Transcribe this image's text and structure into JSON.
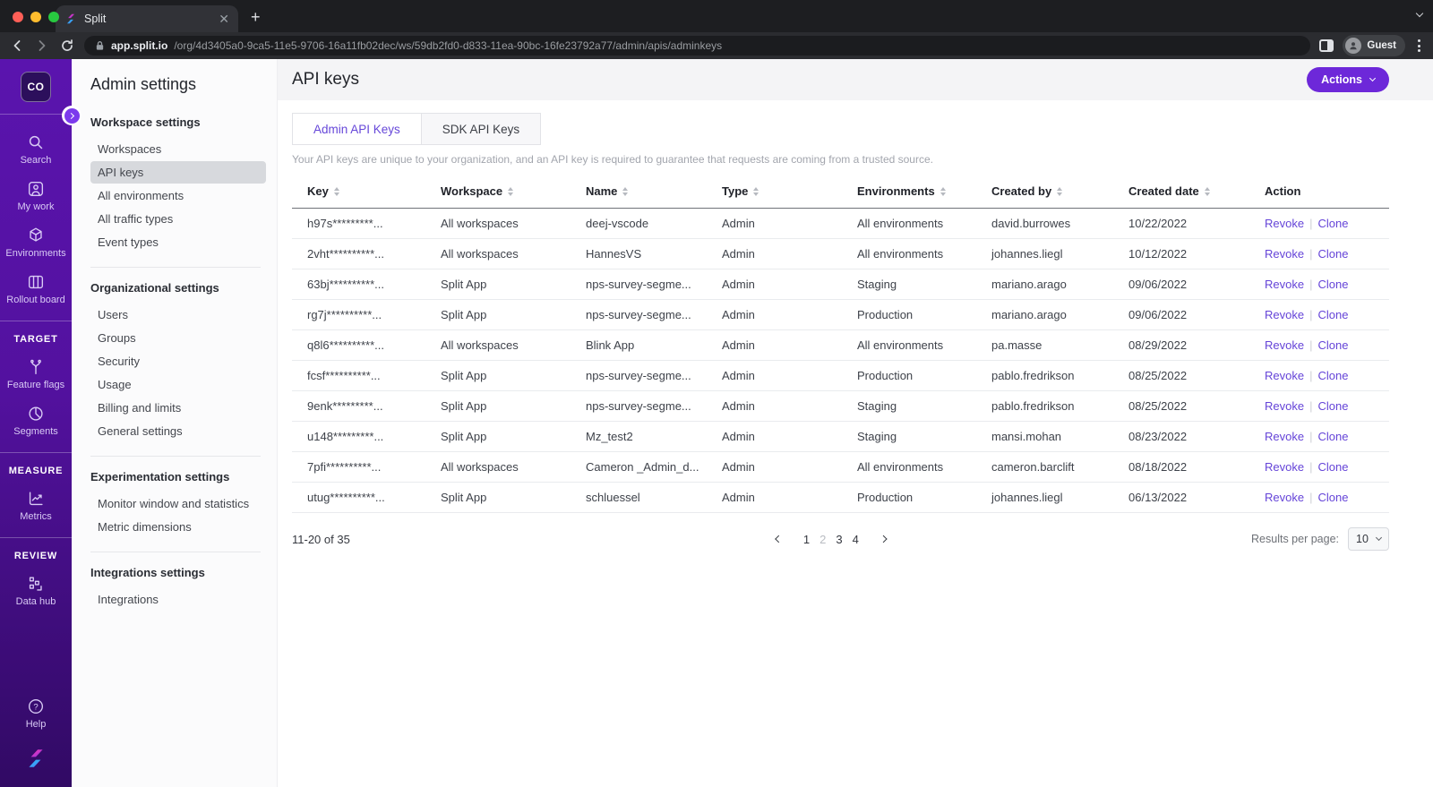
{
  "browser": {
    "tab_title": "Split",
    "url_host": "app.split.io",
    "url_path": "/org/4d3405a0-9ca5-11e5-9706-16a11fb02dec/ws/59db2fd0-d833-11ea-90bc-16fe23792a77/admin/apis/adminkeys",
    "profile_label": "Guest"
  },
  "sidebar": {
    "logo_label": "CO",
    "groups": [
      {
        "kind": "item",
        "icon": "search-icon",
        "label": "Search"
      },
      {
        "kind": "item",
        "icon": "my-work-icon",
        "label": "My work"
      },
      {
        "kind": "item",
        "icon": "environments-icon",
        "label": "Environments"
      },
      {
        "kind": "item",
        "icon": "rollout-board-icon",
        "label": "Rollout board"
      },
      {
        "kind": "divider"
      },
      {
        "kind": "heading",
        "label": "TARGET"
      },
      {
        "kind": "item",
        "icon": "feature-flags-icon",
        "label": "Feature flags"
      },
      {
        "kind": "item",
        "icon": "segments-icon",
        "label": "Segments"
      },
      {
        "kind": "divider"
      },
      {
        "kind": "heading",
        "label": "MEASURE"
      },
      {
        "kind": "item",
        "icon": "metrics-icon",
        "label": "Metrics"
      },
      {
        "kind": "divider"
      },
      {
        "kind": "heading",
        "label": "REVIEW"
      },
      {
        "kind": "item",
        "icon": "data-hub-icon",
        "label": "Data hub"
      }
    ],
    "help_label": "Help"
  },
  "admin_nav": {
    "title": "Admin settings",
    "selected": "API keys",
    "sections": [
      {
        "heading": "Workspace settings",
        "items": [
          "Workspaces",
          "API keys",
          "All environments",
          "All traffic types",
          "Event types"
        ]
      },
      {
        "heading": "Organizational settings",
        "items": [
          "Users",
          "Groups",
          "Security",
          "Usage",
          "Billing and limits",
          "General settings"
        ]
      },
      {
        "heading": "Experimentation settings",
        "items": [
          "Monitor window and statistics",
          "Metric dimensions"
        ]
      },
      {
        "heading": "Integrations settings",
        "items": [
          "Integrations"
        ]
      }
    ]
  },
  "main": {
    "title": "API keys",
    "actions_button": "Actions",
    "tabs": [
      {
        "label": "Admin API Keys",
        "active": true
      },
      {
        "label": "SDK API Keys",
        "active": false
      }
    ],
    "description": "Your API keys are unique to your organization, and an API key is required to guarantee that requests are coming from a trusted source.",
    "table": {
      "columns": [
        {
          "label": "Key",
          "sortable": true
        },
        {
          "label": "Workspace",
          "sortable": true
        },
        {
          "label": "Name",
          "sortable": true
        },
        {
          "label": "Type",
          "sortable": true
        },
        {
          "label": "Environments",
          "sortable": true
        },
        {
          "label": "Created by",
          "sortable": true
        },
        {
          "label": "Created date",
          "sortable": true
        },
        {
          "label": "Action",
          "sortable": false
        }
      ],
      "row_actions": [
        "Revoke",
        "Clone"
      ],
      "rows": [
        [
          "h97s*********...",
          "All workspaces",
          "deej-vscode",
          "Admin",
          "All environments",
          "david.burrowes",
          "10/22/2022"
        ],
        [
          "2vht**********...",
          "All workspaces",
          "HannesVS",
          "Admin",
          "All environments",
          "johannes.liegl",
          "10/12/2022"
        ],
        [
          "63bj**********...",
          "Split App",
          "nps-survey-segme...",
          "Admin",
          "Staging",
          "mariano.arago",
          "09/06/2022"
        ],
        [
          "rg7j**********...",
          "Split App",
          "nps-survey-segme...",
          "Admin",
          "Production",
          "mariano.arago",
          "09/06/2022"
        ],
        [
          "q8l6**********...",
          "All workspaces",
          "Blink App",
          "Admin",
          "All environments",
          "pa.masse",
          "08/29/2022"
        ],
        [
          "fcsf**********...",
          "Split App",
          "nps-survey-segme...",
          "Admin",
          "Production",
          "pablo.fredrikson",
          "08/25/2022"
        ],
        [
          "9enk*********...",
          "Split App",
          "nps-survey-segme...",
          "Admin",
          "Staging",
          "pablo.fredrikson",
          "08/25/2022"
        ],
        [
          "u148*********...",
          "Split App",
          "Mz_test2",
          "Admin",
          "Staging",
          "mansi.mohan",
          "08/23/2022"
        ],
        [
          "7pfi**********...",
          "All workspaces",
          "Cameron _Admin_d...",
          "Admin",
          "All environments",
          "cameron.barclift",
          "08/18/2022"
        ],
        [
          "utug**********...",
          "Split App",
          "schluessel",
          "Admin",
          "Production",
          "johannes.liegl",
          "06/13/2022"
        ]
      ]
    },
    "pagination": {
      "range_label": "11-20 of 35",
      "pages": [
        "1",
        "2",
        "3",
        "4"
      ],
      "current_page": "2",
      "results_per_page_label": "Results per page:",
      "results_per_page_value": "10"
    }
  },
  "colors": {
    "accent_purple": "#6d28d9",
    "link_purple": "#6544d8",
    "rail_gradient_top": "#5a14ae",
    "rail_gradient_bottom": "#310a64",
    "selected_nav_bg": "#d7d9dd",
    "traffic_red": "#ff5f57",
    "traffic_yellow": "#febc2e",
    "traffic_green": "#28c840"
  }
}
